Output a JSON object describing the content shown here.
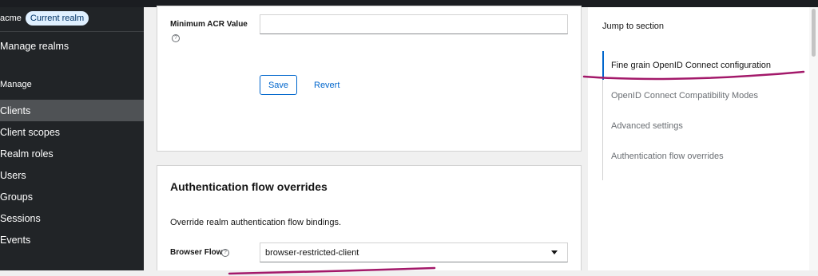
{
  "sidebar": {
    "realm_name": "acme",
    "realm_badge": "Current realm",
    "manage_realms": "Manage realms",
    "group_label": "Manage",
    "items": [
      {
        "label": "Clients"
      },
      {
        "label": "Client scopes"
      },
      {
        "label": "Realm roles"
      },
      {
        "label": "Users"
      },
      {
        "label": "Groups"
      },
      {
        "label": "Sessions"
      },
      {
        "label": "Events"
      }
    ]
  },
  "acr_card": {
    "label": "Minimum ACR Value",
    "help_glyph": "?",
    "value": "",
    "save_label": "Save",
    "revert_label": "Revert"
  },
  "auth_flow": {
    "title": "Authentication flow overrides",
    "description": "Override realm authentication flow bindings.",
    "browser_flow_label": "Browser Flow",
    "help_glyph": "?",
    "browser_flow_value": "browser-restricted-client"
  },
  "jump": {
    "title": "Jump to section",
    "items": [
      {
        "label": "Fine grain OpenID Connect configuration"
      },
      {
        "label": "OpenID Connect Compatibility Modes"
      },
      {
        "label": "Advanced settings"
      },
      {
        "label": "Authentication flow overrides"
      }
    ]
  },
  "colors": {
    "accent": "#0066cc",
    "sidebar_bg": "#212427",
    "annotation": "#a3196a"
  }
}
